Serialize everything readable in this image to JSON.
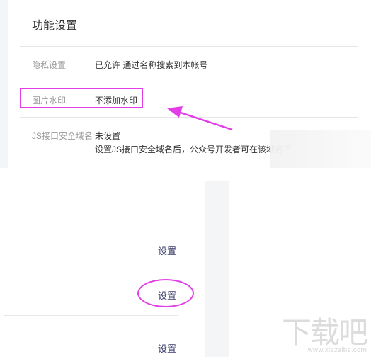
{
  "settings": {
    "title": "功能设置",
    "rows": [
      {
        "label": "隐私设置",
        "value": "已允许 通过名称搜索到本帐号"
      },
      {
        "label": "图片水印",
        "value": "不添加水印"
      },
      {
        "label": "JS接口安全域名",
        "value": "未设置",
        "description": "设置JS接口安全域名后，公众号开发者可在该域名下"
      }
    ]
  },
  "actions": {
    "set_label_1": "设置",
    "set_label_2": "设置",
    "set_label_3": "设置"
  },
  "watermark": {
    "logo": "下载吧",
    "url": "www.xiazaiba.com"
  },
  "colors": {
    "highlight": "#e23de6",
    "label": "#9a9a9a",
    "text": "#333333",
    "divider": "#e7e7eb"
  }
}
